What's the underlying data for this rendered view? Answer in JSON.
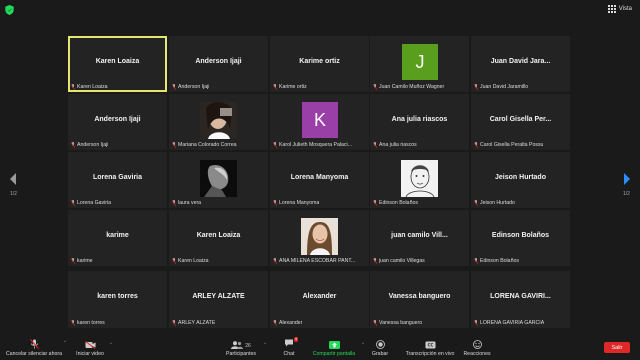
{
  "window": {
    "view_label": "Vista"
  },
  "pagination": {
    "left": "1/2",
    "right": "1/2"
  },
  "tiles": [
    {
      "display": "Karen Loaiza",
      "label": "Karen Loaiza",
      "active": true
    },
    {
      "display": "Anderson Ijaji",
      "label": "Anderson Ijaji"
    },
    {
      "display": "Karime ortiz",
      "label": "Karime ortiz"
    },
    {
      "avatar_letter": "J",
      "avatar_color": "#5a9e1e",
      "label": "Juan Camilo Muñoz Wagner"
    },
    {
      "display": "Juan David Jara...",
      "label": "Juan David Jaramillo"
    },
    {
      "display": "Anderson Ijaji",
      "label": "Anderson Ijaji"
    },
    {
      "photo": "selfie-dark",
      "label": "Mariana Colorado Correa"
    },
    {
      "avatar_letter": "K",
      "avatar_color": "#9a3ea8",
      "label": "Karol Julieth Mosquera Palaci..."
    },
    {
      "display": "Ana julia riascos",
      "label": "Ana julia riascos"
    },
    {
      "display": "Carol Gisella Per...",
      "label": "Carol Gisella Peralta Possu"
    },
    {
      "display": "Lorena Gaviria",
      "label": "Lorena Gaviria"
    },
    {
      "photo": "bw-profile",
      "label": "laura vera"
    },
    {
      "display": "Lorena Manyoma",
      "label": "Lorena Manyoma"
    },
    {
      "photo": "sketch-face",
      "label": "Edinson Bolaños"
    },
    {
      "display": "Jeison Hurtado",
      "label": "Jeison Hurtado"
    },
    {
      "display": "karime",
      "label": "karime"
    },
    {
      "display": "Karen Loaiza",
      "label": "Karen Loaiza"
    },
    {
      "photo": "woman-portrait",
      "label": "ANA MILENA ESCOBAR PANT..."
    },
    {
      "display": "juan camilo Vill...",
      "label": "juan camilo Villegas"
    },
    {
      "display": "Edinson Bolaños",
      "label": "Edinson Bolaños"
    },
    {
      "display": "karen torres",
      "label": "karen torres"
    },
    {
      "display": "ARLEY ALZATE",
      "label": "ARLEY ALZATE"
    },
    {
      "display": "Alexander",
      "label": "Alexander"
    },
    {
      "display": "Vanessa banguero",
      "label": "Vanessa banguero"
    },
    {
      "display": "LORENA GAVIRI...",
      "label": "LORENA GAVIRIA GARCIA"
    }
  ],
  "toolbar": {
    "unmute": "Cancelar silenciar ahora",
    "video": "Iniciar video",
    "participants": "Participantes",
    "participants_count": "26",
    "chat": "Chat",
    "chat_badge": "4",
    "share": "Compartir pantalla",
    "record": "Grabar",
    "live": "Transcripción en vivo",
    "reactions": "Reacciones",
    "leave": "Salir"
  },
  "colors": {
    "accent_green": "#23d959",
    "active_border": "#e5e570",
    "leave_red": "#e02828",
    "nav_blue": "#2d8cff"
  }
}
